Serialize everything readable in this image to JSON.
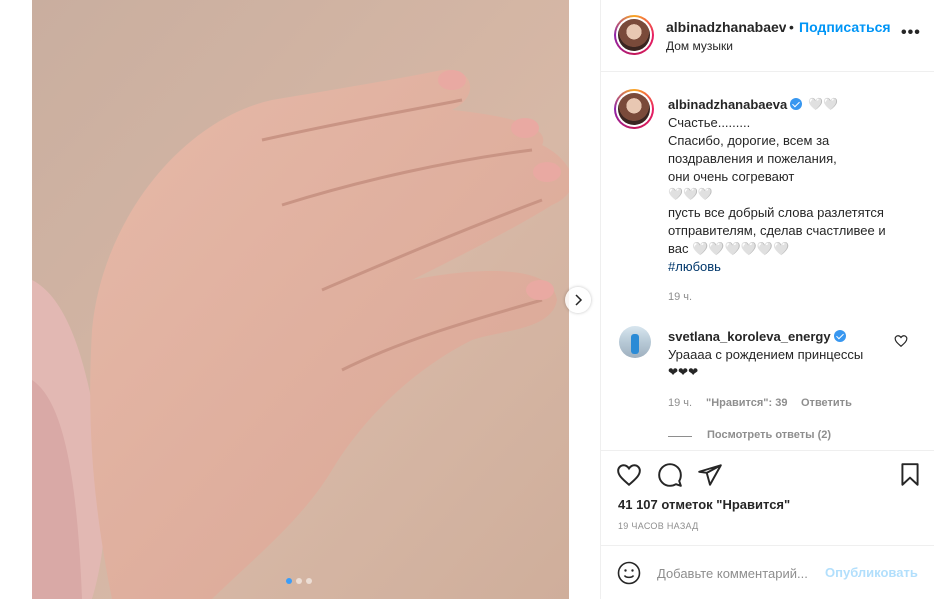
{
  "header": {
    "username": "albinadzhanabaeva",
    "separator": "•",
    "follow_label": "Подписаться",
    "location": "Дом музыки",
    "more_label": "•••"
  },
  "media": {
    "slides": 3,
    "active_slide": 1,
    "subject": "baby hand photo"
  },
  "caption": {
    "username": "albinadzhanabaeva",
    "emoji": "🤍🤍",
    "lines": [
      "Счастье.........",
      "Спасибо, дорогие, всем за",
      "поздравления и пожелания,",
      "они очень согревают",
      "🤍🤍🤍",
      "пусть все добрый слова разлетятся",
      "отправителям, сделав счастливее и",
      "вас 🤍🤍🤍🤍🤍🤍"
    ],
    "hashtag": "#любовь",
    "time": "19 ч."
  },
  "comment": {
    "username": "svetlana_koroleva_energy",
    "text": "Ураааа с рождением принцессы",
    "hearts": "❤❤❤",
    "time": "19 ч.",
    "likes_label": "\"Нравится\": 39",
    "reply_label": "Ответить",
    "view_replies": "Посмотреть ответы (2)"
  },
  "actions": {
    "icons": [
      "heart-icon",
      "comment-icon",
      "share-icon",
      "bookmark-icon"
    ]
  },
  "likes_text": "41 107 отметок \"Нравится\"",
  "post_time": "19 ЧАСОВ НАЗАД",
  "comment_box": {
    "placeholder": "Добавьте комментарий...",
    "publish_label": "Опубликовать"
  },
  "colors": {
    "link_blue": "#0095f6",
    "publish_disabled": "#b2dffc",
    "muted": "#8e8e8e",
    "verified": "#3897f0"
  }
}
